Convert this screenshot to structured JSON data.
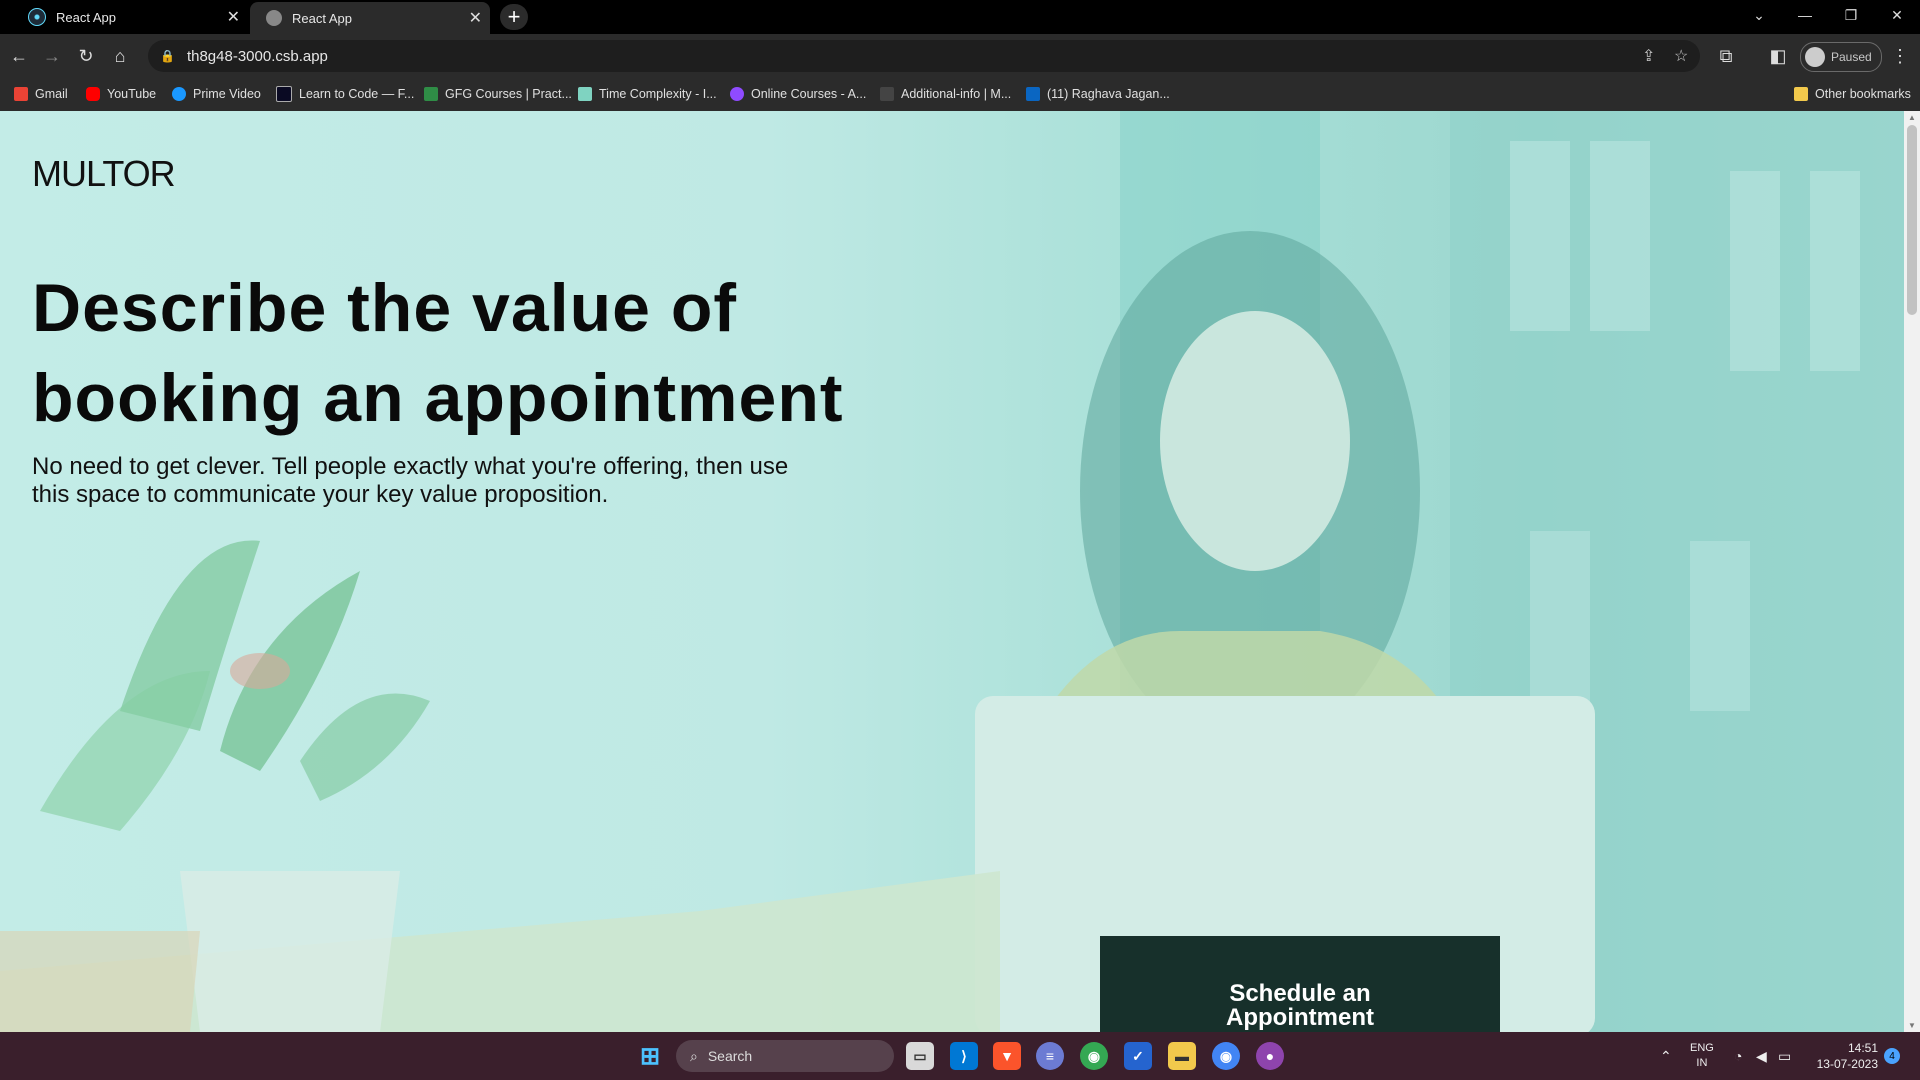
{
  "browser": {
    "tabs": [
      {
        "label": "React App",
        "close": "✕"
      },
      {
        "label": "React App",
        "close": "✕"
      }
    ],
    "new_tab": "+",
    "url": "th8g48-3000.csb.app",
    "profile_label": "Paused",
    "bookmarks": [
      {
        "label": "Gmail",
        "icon": "gmail-icon",
        "color": "#ea4335"
      },
      {
        "label": "YouTube",
        "icon": "youtube-icon",
        "color": "#ff0000"
      },
      {
        "label": "Prime Video",
        "icon": "prime-video-icon",
        "color": "#1a98ff"
      },
      {
        "label": "Learn to Code — F...",
        "icon": "freecodecamp-icon",
        "color": "#0a0a23"
      },
      {
        "label": "GFG Courses | Pract...",
        "icon": "gfg-icon",
        "color": "#2f8d46"
      },
      {
        "label": "Time Complexity - I...",
        "icon": "mountain-icon",
        "color": "#7fd3c1"
      },
      {
        "label": "Online Courses - A...",
        "icon": "courses-icon",
        "color": "#8f4bff"
      },
      {
        "label": "Additional-info | M...",
        "icon": "doc-icon",
        "color": "#444444"
      },
      {
        "label": "(11) Raghava Jagan...",
        "icon": "linkedin-icon",
        "color": "#0a66c2"
      }
    ],
    "other_bookmarks": "Other bookmarks"
  },
  "page": {
    "logo": "MULTOR",
    "hero_title": "Describe the value of booking an appointment",
    "hero_subtitle": "No need to get clever. Tell people exactly what you're offering, then use this space to communicate your key value proposition.",
    "cta_label": "Schedule an Appointment",
    "colors": {
      "overlay": "#a9e0d8",
      "cta_bg": "#17302b"
    }
  },
  "taskbar": {
    "search_placeholder": "Search",
    "lang_top": "ENG",
    "lang_bottom": "IN",
    "time": "14:51",
    "date": "13-07-2023",
    "notification_count": "4"
  }
}
